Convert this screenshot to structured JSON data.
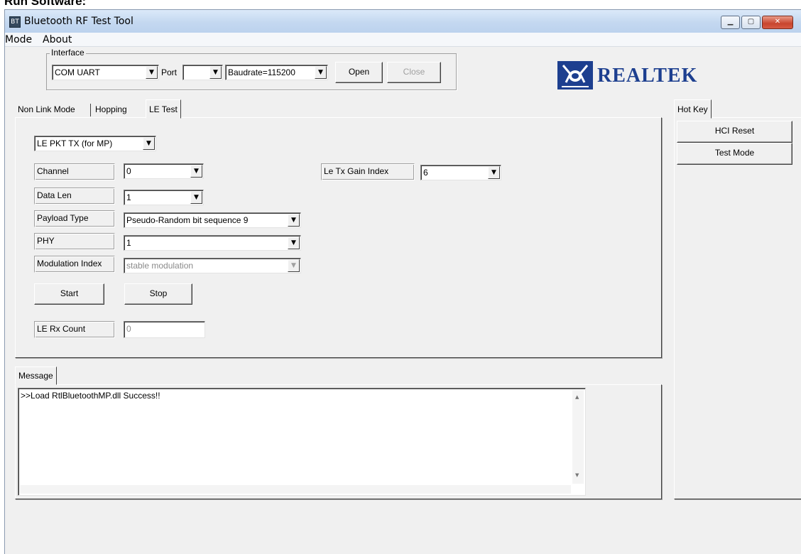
{
  "doc_heading": "Run Software:",
  "window": {
    "title": "Bluetooth RF Test Tool",
    "app_icon_glyph": "BT",
    "caption_buttons": {
      "minimize": "▁",
      "maximize": "▢",
      "close": "✕"
    }
  },
  "menu": {
    "items": [
      "Mode",
      "About"
    ]
  },
  "interface": {
    "group_label": "Interface",
    "type_value": "COM UART",
    "port_label": "Port",
    "port_value": "",
    "baudrate_value": "Baudrate=115200",
    "open_label": "Open",
    "close_label": "Close"
  },
  "logo": {
    "text": "REALTEK",
    "brand_color": "#1d3f8f"
  },
  "tabs": {
    "non_link": "Non Link Mode",
    "hopping": "Hopping",
    "le_test": "LE Test"
  },
  "le_test": {
    "mode_value": "LE PKT TX (for MP)",
    "channel_label": "Channel",
    "channel_value": "0",
    "data_len_label": "Data Len",
    "data_len_value": "1",
    "payload_label": "Payload Type",
    "payload_value": "Pseudo-Random bit sequence 9",
    "phy_label": "PHY",
    "phy_value": "1",
    "modulation_label": "Modulation Index",
    "modulation_value": "stable modulation",
    "gain_label": "Le Tx Gain Index",
    "gain_value": "6",
    "start_label": "Start",
    "stop_label": "Stop",
    "rx_count_label": "LE Rx Count",
    "rx_count_value": "0"
  },
  "message": {
    "tab_label": "Message",
    "text": ">>Load RtlBluetoothMP.dll Success!!"
  },
  "hotkey": {
    "tab_label": "Hot Key",
    "hci_reset_label": "HCI Reset",
    "test_mode_label": "Test Mode"
  },
  "icons": {
    "dropdown_arrow": "▼",
    "scroll_up": "▲",
    "scroll_down": "▼"
  }
}
